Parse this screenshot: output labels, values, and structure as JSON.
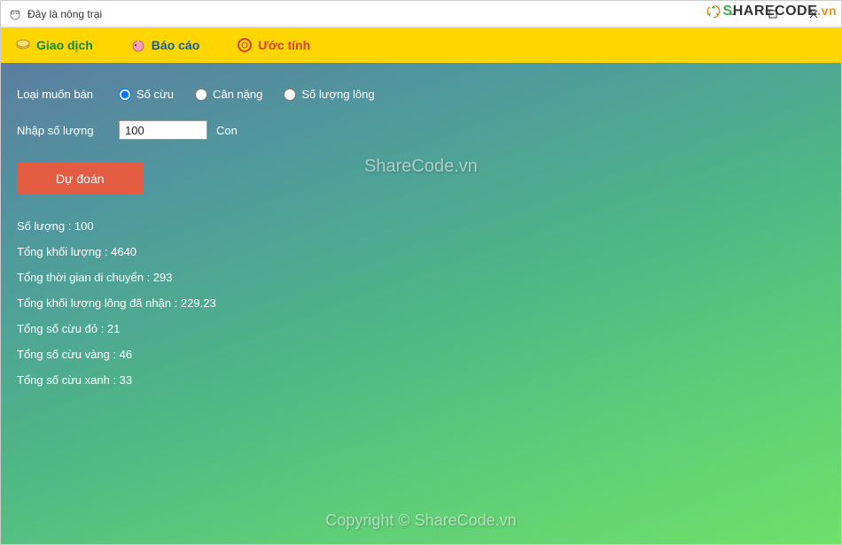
{
  "window": {
    "title": "Đây là nông trại"
  },
  "brand": {
    "text_s": "S",
    "text_rest": "HARECODE",
    "text_suffix": ".vn"
  },
  "menu": {
    "items": [
      {
        "label": "Giao dịch"
      },
      {
        "label": "Báo cáo"
      },
      {
        "label": "Ước tính"
      }
    ]
  },
  "form": {
    "type_label": "Loại muốn bán",
    "radios": [
      {
        "label": "Số cừu",
        "checked": true
      },
      {
        "label": "Cân nặng",
        "checked": false
      },
      {
        "label": "Số lượng lông",
        "checked": false
      }
    ],
    "qty_label": "Nhập số lượng",
    "qty_value": "100",
    "qty_unit": "Con",
    "predict_label": "Dự đoán"
  },
  "results": {
    "lines": [
      "Số lượng : 100",
      "Tổng khối lượng : 4640",
      "Tổng thời gian di chuyển : 293",
      "Tổng khối lượng lông đã nhận : 229.23",
      "Tổng số cừu đỏ : 21",
      "Tổng số cừu vàng : 46",
      "Tổng số cừu xanh : 33"
    ]
  },
  "watermarks": {
    "center": "ShareCode.vn",
    "bottom": "Copyright © ShareCode.vn"
  }
}
